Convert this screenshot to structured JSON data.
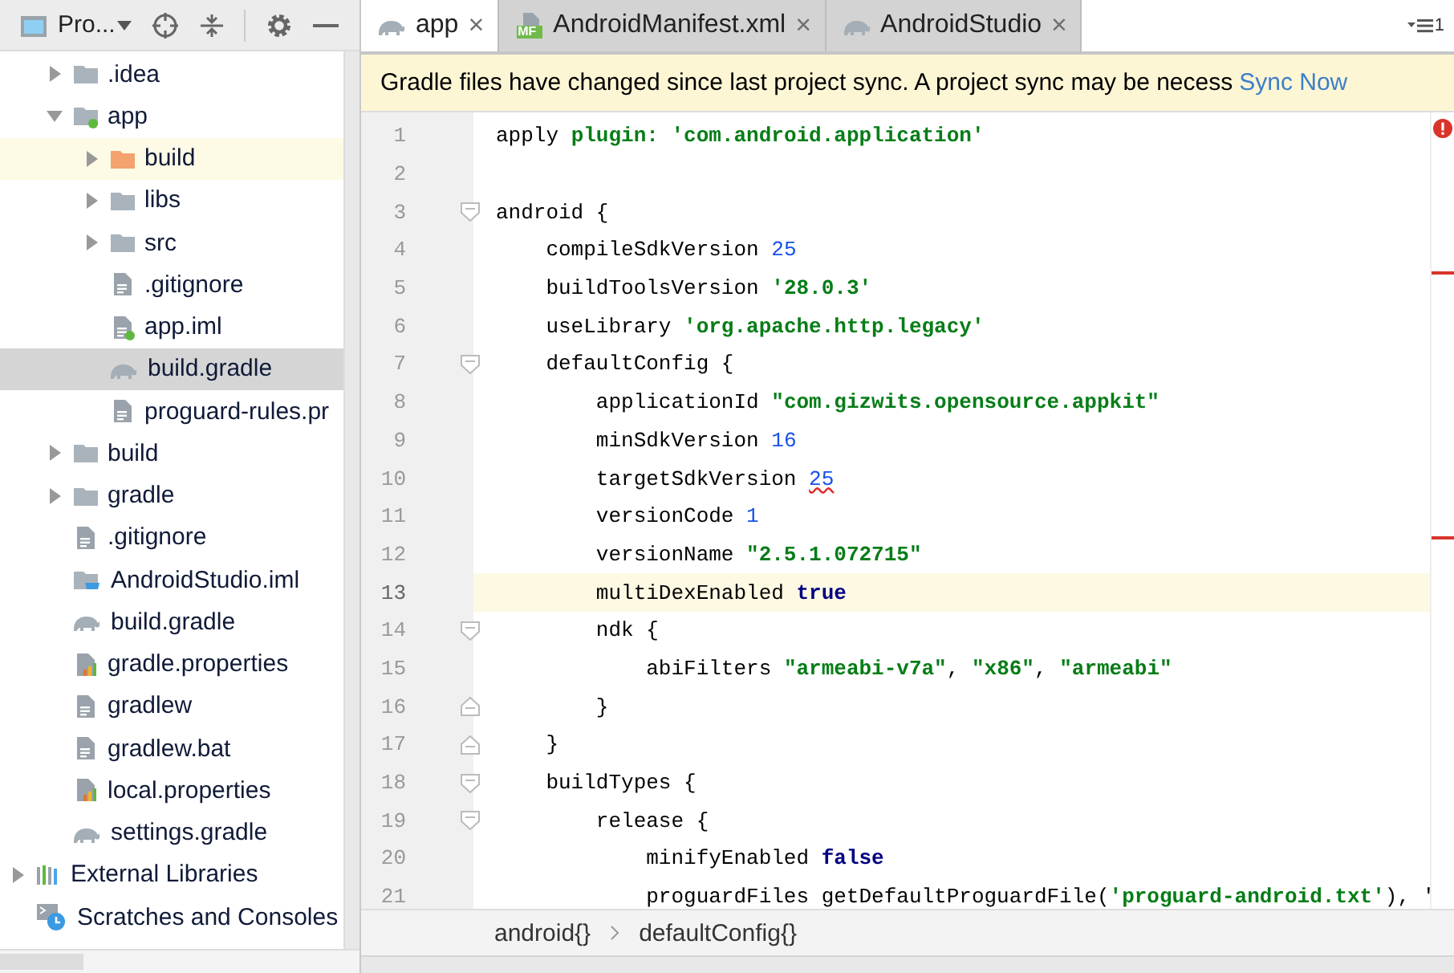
{
  "project_toolbar": {
    "selector": "Pro..."
  },
  "tree": {
    "items": [
      {
        "kind": "hidden-parent",
        "children": [
          {
            "name": ".idea",
            "kind": "folder",
            "expanded": false,
            "selected": false,
            "highlighted": false
          },
          {
            "name": "app",
            "kind": "module-folder",
            "expanded": true,
            "selected": false,
            "highlighted": false,
            "children": [
              {
                "name": "build",
                "kind": "excluded-folder",
                "expanded": false,
                "selected": false,
                "highlighted": true
              },
              {
                "name": "libs",
                "kind": "folder",
                "expanded": false,
                "selected": false,
                "highlighted": false
              },
              {
                "name": "src",
                "kind": "folder",
                "expanded": false,
                "selected": false,
                "highlighted": false
              },
              {
                "name": ".gitignore",
                "kind": "text-file",
                "selected": false,
                "highlighted": false
              },
              {
                "name": "app.iml",
                "kind": "module-file",
                "selected": false,
                "highlighted": false
              },
              {
                "name": "build.gradle",
                "kind": "gradle",
                "selected": true,
                "highlighted": false
              },
              {
                "name": "proguard-rules.pr",
                "kind": "text-file",
                "selected": false,
                "highlighted": false
              }
            ]
          },
          {
            "name": "build",
            "kind": "folder",
            "expanded": false,
            "selected": false,
            "highlighted": false
          },
          {
            "name": "gradle",
            "kind": "folder",
            "expanded": false,
            "selected": false,
            "highlighted": false
          },
          {
            "name": ".gitignore",
            "kind": "text-file",
            "selected": false,
            "highlighted": false
          },
          {
            "name": "AndroidStudio.iml",
            "kind": "project-file",
            "selected": false,
            "highlighted": false
          },
          {
            "name": "build.gradle",
            "kind": "gradle",
            "selected": false,
            "highlighted": false
          },
          {
            "name": "gradle.properties",
            "kind": "properties",
            "selected": false,
            "highlighted": false
          },
          {
            "name": "gradlew",
            "kind": "text-file",
            "selected": false,
            "highlighted": false
          },
          {
            "name": "gradlew.bat",
            "kind": "text-file",
            "selected": false,
            "highlighted": false
          },
          {
            "name": "local.properties",
            "kind": "properties",
            "selected": false,
            "highlighted": false
          },
          {
            "name": "settings.gradle",
            "kind": "gradle",
            "selected": false,
            "highlighted": false
          }
        ]
      },
      {
        "name": "External Libraries",
        "kind": "libraries",
        "expanded": false,
        "selected": false,
        "highlighted": false
      },
      {
        "name": "Scratches and Consoles",
        "kind": "scratches",
        "selected": false,
        "highlighted": false
      }
    ]
  },
  "tabs": [
    {
      "label": "app",
      "kind": "gradle",
      "selected": true,
      "close": "×"
    },
    {
      "label": "AndroidManifest.xml",
      "kind": "manifest",
      "badge": "MF",
      "selected": false,
      "close": "×"
    },
    {
      "label": "AndroidStudio",
      "kind": "gradle",
      "selected": false,
      "close": "×"
    }
  ],
  "tab_overflow": {
    "count": "1"
  },
  "banner": {
    "message": "Gradle files have changed since last project sync. A project sync may be necess",
    "link": "Sync Now"
  },
  "editor": {
    "lines": [
      {
        "n": "1",
        "current": false,
        "tokens": [
          {
            "text": "apply ",
            "kind": "plain"
          },
          {
            "text": "plugin: ",
            "kind": "string"
          },
          {
            "text": "'com.android.application'",
            "kind": "string"
          }
        ]
      },
      {
        "n": "2",
        "current": false
      },
      {
        "n": "3",
        "current": false,
        "kind": "fold-start",
        "tokens": [
          {
            "text": "android {",
            "kind": "plain"
          }
        ]
      },
      {
        "n": "4",
        "current": false,
        "tokens": [
          {
            "text": "    compileSdkVersion ",
            "kind": "plain"
          },
          {
            "text": "25",
            "kind": "number"
          }
        ]
      },
      {
        "n": "5",
        "current": false,
        "tokens": [
          {
            "text": "    buildToolsVersion ",
            "kind": "plain"
          },
          {
            "text": "'28.0.3'",
            "kind": "string"
          }
        ]
      },
      {
        "n": "6",
        "current": false,
        "tokens": [
          {
            "text": "    useLibrary ",
            "kind": "plain"
          },
          {
            "text": "'org.apache.http.legacy'",
            "kind": "string"
          }
        ]
      },
      {
        "n": "7",
        "current": false,
        "kind": "fold-start",
        "tokens": [
          {
            "text": "    defaultConfig {",
            "kind": "plain"
          }
        ]
      },
      {
        "n": "8",
        "current": false,
        "tokens": [
          {
            "text": "        applicationId ",
            "kind": "plain"
          },
          {
            "text": "\"com.gizwits.opensource.appkit\"",
            "kind": "string"
          }
        ]
      },
      {
        "n": "9",
        "current": false,
        "tokens": [
          {
            "text": "        minSdkVersion ",
            "kind": "plain"
          },
          {
            "text": "16",
            "kind": "number"
          }
        ]
      },
      {
        "n": "10",
        "current": false,
        "tokens": [
          {
            "text": "        targetSdkVersion ",
            "kind": "plain"
          },
          {
            "text": "25",
            "kind": "number-warning"
          }
        ]
      },
      {
        "n": "11",
        "current": false,
        "tokens": [
          {
            "text": "        versionCode ",
            "kind": "plain"
          },
          {
            "text": "1",
            "kind": "number"
          }
        ]
      },
      {
        "n": "12",
        "current": false,
        "tokens": [
          {
            "text": "        versionName ",
            "kind": "plain"
          },
          {
            "text": "\"2.5.1.072715\"",
            "kind": "string"
          }
        ]
      },
      {
        "n": "13",
        "current": true,
        "tokens": [
          {
            "text": "        multiDexEnabled ",
            "kind": "plain"
          },
          {
            "text": "true",
            "kind": "keyword"
          }
        ]
      },
      {
        "n": "14",
        "current": false,
        "kind": "fold-start",
        "tokens": [
          {
            "text": "        ndk {",
            "kind": "plain"
          }
        ]
      },
      {
        "n": "15",
        "current": false,
        "tokens": [
          {
            "text": "            abiFilters ",
            "kind": "plain"
          },
          {
            "text": "\"armeabi-v7a\"",
            "kind": "string"
          },
          {
            "text": ", ",
            "kind": "plain"
          },
          {
            "text": "\"x86\"",
            "kind": "string"
          },
          {
            "text": ", ",
            "kind": "plain"
          },
          {
            "text": "\"armeabi\"",
            "kind": "string"
          }
        ]
      },
      {
        "n": "16",
        "current": false,
        "kind": "fold-end",
        "tokens": [
          {
            "text": "        }",
            "kind": "plain"
          }
        ]
      },
      {
        "n": "17",
        "current": false,
        "kind": "fold-end",
        "tokens": [
          {
            "text": "    }",
            "kind": "plain"
          }
        ]
      },
      {
        "n": "18",
        "current": false,
        "kind": "fold-start",
        "tokens": [
          {
            "text": "    buildTypes {",
            "kind": "plain"
          }
        ]
      },
      {
        "n": "19",
        "current": false,
        "kind": "fold-start",
        "tokens": [
          {
            "text": "        release {",
            "kind": "plain"
          }
        ]
      },
      {
        "n": "20",
        "current": false,
        "tokens": [
          {
            "text": "            minifyEnabled ",
            "kind": "plain"
          },
          {
            "text": "false",
            "kind": "keyword"
          }
        ]
      },
      {
        "n": "21",
        "current": false,
        "tokens": [
          {
            "text": "            proguardFiles getDefaultProguardFile(",
            "kind": "plain"
          },
          {
            "text": "'proguard-android.txt'",
            "kind": "string"
          },
          {
            "text": "), '",
            "kind": "plain"
          }
        ]
      }
    ]
  },
  "breadcrumb": [
    "android{}",
    "defaultConfig{}"
  ]
}
